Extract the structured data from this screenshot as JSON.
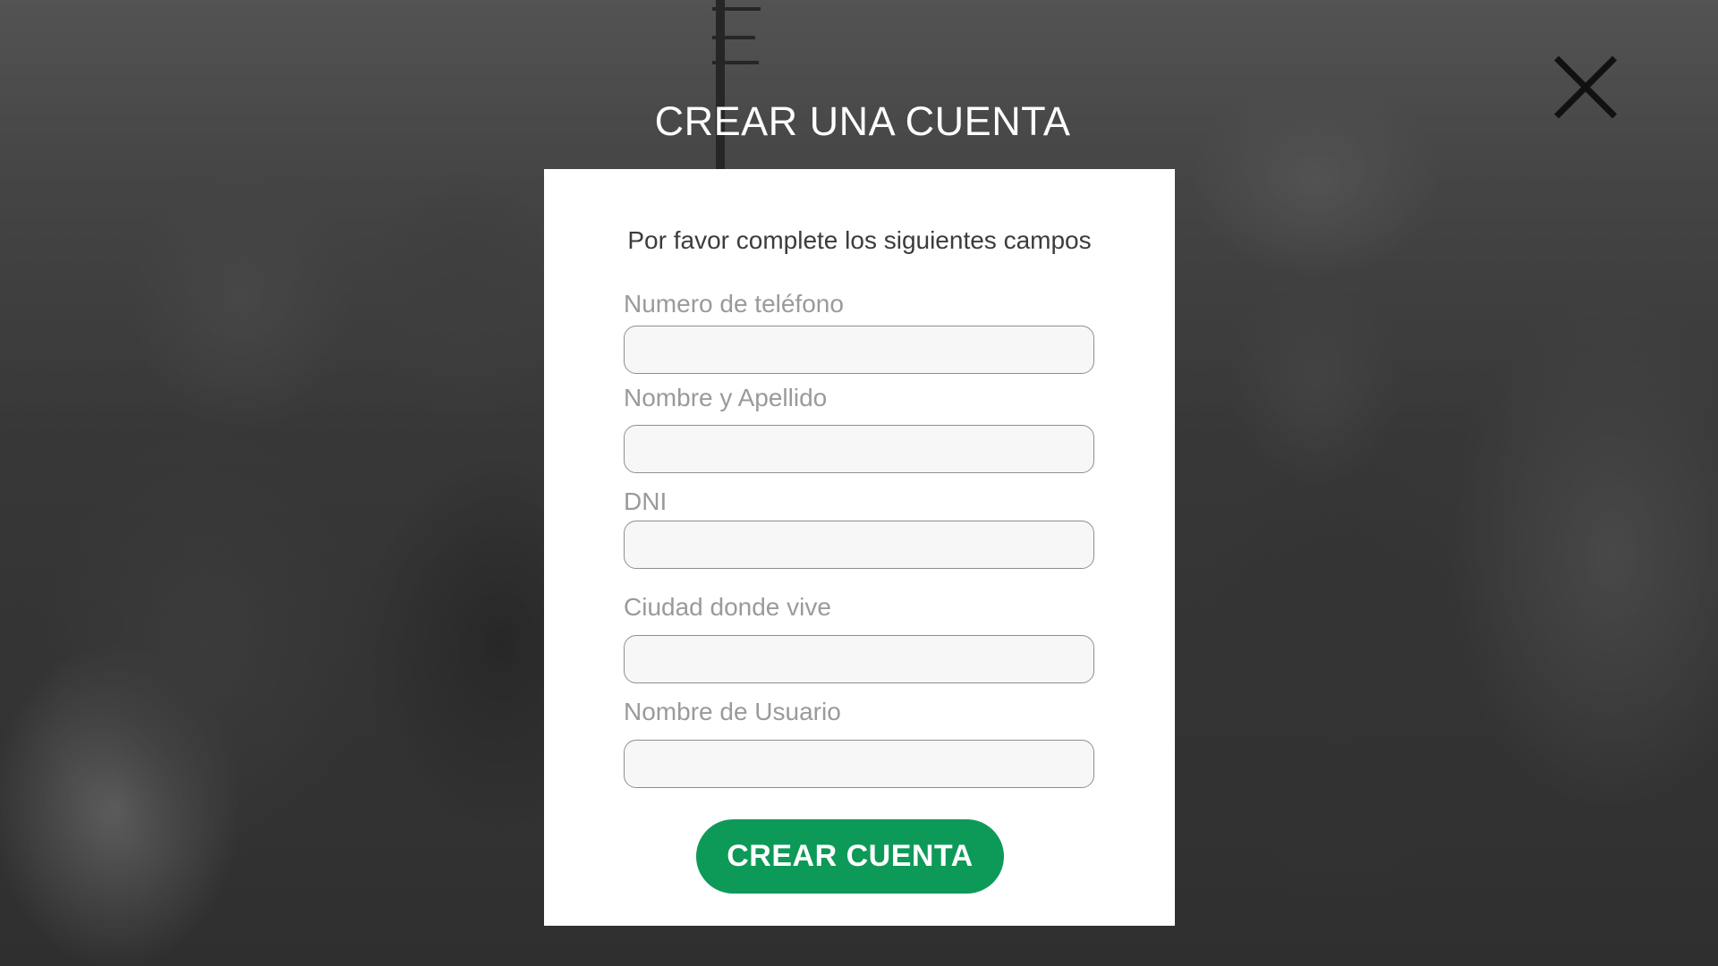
{
  "modal": {
    "title": "CREAR UNA CUENTA",
    "instructions": "Por favor complete los siguientes campos",
    "close_icon": "close-icon"
  },
  "form": {
    "fields": [
      {
        "label": "Numero de teléfono",
        "value": "",
        "placeholder": ""
      },
      {
        "label": "Nombre y Apellido",
        "value": "",
        "placeholder": ""
      },
      {
        "label": "DNI",
        "value": "",
        "placeholder": ""
      },
      {
        "label": "Ciudad donde vive",
        "value": "",
        "placeholder": ""
      },
      {
        "label": "Nombre de Usuario",
        "value": "",
        "placeholder": ""
      }
    ],
    "submit_label": "CREAR CUENTA"
  },
  "colors": {
    "submit_button": "#0d9a58",
    "panel": "#ffffff",
    "label": "#9a9a9a",
    "close_icon": "#111111"
  }
}
